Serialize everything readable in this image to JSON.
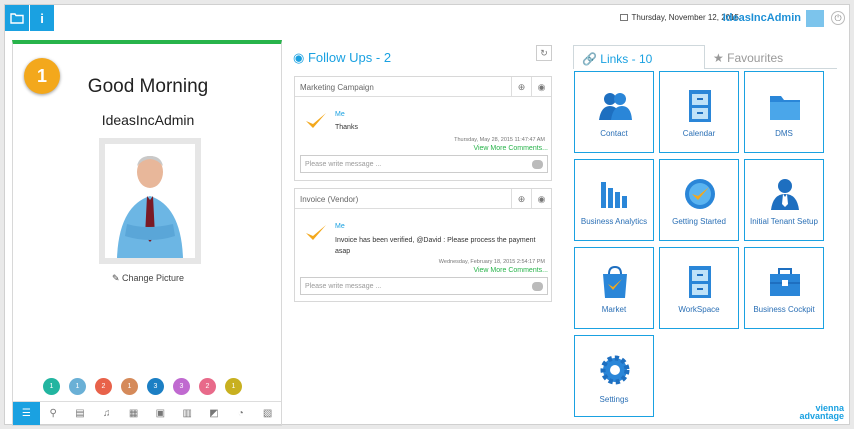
{
  "header": {
    "date": "Thursday, November 12, 2015",
    "user": "IdeasIncAdmin"
  },
  "profile": {
    "step": "1",
    "greeting": "Good Morning",
    "username": "IdeasIncAdmin",
    "change_picture": "Change Picture",
    "counters": [
      {
        "value": "1",
        "color": "#22b5a0"
      },
      {
        "value": "1",
        "color": "#6ab0d6"
      },
      {
        "value": "2",
        "color": "#e8624a"
      },
      {
        "value": "1",
        "color": "#d58a5a"
      },
      {
        "value": "3",
        "color": "#1c7fc4"
      },
      {
        "value": "3",
        "color": "#c06ad0"
      },
      {
        "value": "2",
        "color": "#e86a8a"
      },
      {
        "value": "1",
        "color": "#c8b020"
      }
    ]
  },
  "followups": {
    "title": "Follow Ups - 2",
    "cards": [
      {
        "subject": "Marketing Campaign",
        "author": "Me",
        "message": "Thanks",
        "timestamp": "Thursday, May 28, 2015 11:47:47 AM",
        "more": "View More Comments...",
        "placeholder": "Please write message ..."
      },
      {
        "subject": "Invoice (Vendor)",
        "author": "Me",
        "message": "Invoice has been verified, @David : Please process the payment asap",
        "timestamp": "Wednesday, February 18, 2015 2:54:17 PM",
        "more": "View More Comments...",
        "placeholder": "Please write message ..."
      }
    ]
  },
  "links": {
    "title": "Links - 10",
    "favourites": "Favourites",
    "tiles": [
      {
        "label": "Contact",
        "icon": "contact-icon"
      },
      {
        "label": "Calendar",
        "icon": "cabinet-icon"
      },
      {
        "label": "DMS",
        "icon": "folder-icon"
      },
      {
        "label": "Business Analytics",
        "icon": "bar-chart-icon"
      },
      {
        "label": "Getting Started",
        "icon": "check-badge-icon"
      },
      {
        "label": "Initial Tenant Setup",
        "icon": "user-icon"
      },
      {
        "label": "Market",
        "icon": "shopping-bag-icon"
      },
      {
        "label": "WorkSpace",
        "icon": "drawer-icon"
      },
      {
        "label": "Business Cockpit",
        "icon": "briefcase-icon"
      },
      {
        "label": "Settings",
        "icon": "gear-icon"
      }
    ]
  },
  "brand": {
    "line1": "vienna",
    "line2": "advantage"
  }
}
